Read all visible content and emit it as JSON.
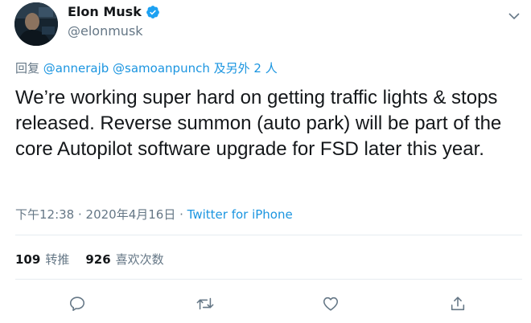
{
  "author": {
    "display_name": "Elon Musk",
    "handle": "@elonmusk",
    "verified_icon": "verified-badge-icon",
    "avatar_icon": "avatar"
  },
  "reply_context": {
    "prefix": "回复 ",
    "mentions": [
      "@annerajb",
      "@samoanpunch"
    ],
    "others": "及另外 2 人"
  },
  "tweet": {
    "text": "We’re working super hard on getting traffic lights & stops released. Reverse summon (auto park) will be part of the core Autopilot software upgrade for FSD later this year."
  },
  "meta": {
    "timestamp": "下午12:38 · 2020年4月16日",
    "separator": " · ",
    "source": "Twitter for iPhone"
  },
  "stats": {
    "retweets_count": "109",
    "retweets_label": "转推",
    "likes_count": "926",
    "likes_label": "喜欢次数"
  },
  "actions": {
    "reply_icon": "reply-icon",
    "retweet_icon": "retweet-icon",
    "like_icon": "like-icon",
    "share_icon": "share-icon"
  },
  "colors": {
    "link": "#1b95e0",
    "muted": "#657786",
    "text": "#14171a",
    "divider": "#e6ecf0",
    "verified": "#1da1f2"
  }
}
